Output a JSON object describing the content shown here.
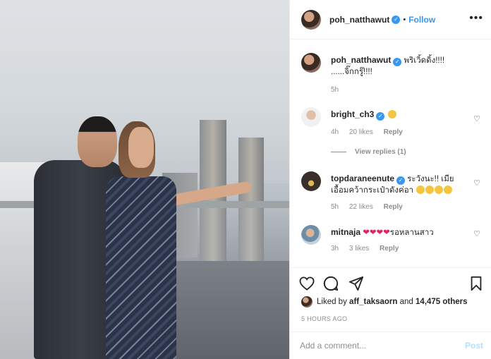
{
  "post": {
    "author": "poh_natthawut",
    "follow_label": "Follow",
    "more_label": "•••"
  },
  "caption": {
    "username": "poh_natthawut",
    "text_line1": "พริเวิ้ดดิ้ง!!!!",
    "text_line2": "......จิ๊กกรู๊!!!!",
    "time": "5h"
  },
  "comments": [
    {
      "username": "bright_ch3",
      "verified": true,
      "text": "",
      "emoji": "star-struck",
      "time": "4h",
      "likes": "20 likes",
      "reply": "Reply",
      "view_replies": "View replies (1)"
    },
    {
      "username": "topdaraneenute",
      "verified": true,
      "text_line1": "ระวังนะ!! เมีย",
      "text_line2": "เอื้อมคว้ากระเป๋าดังค่อา",
      "time": "5h",
      "likes": "22 likes",
      "reply": "Reply"
    },
    {
      "username": "mitnaja",
      "verified": false,
      "text": "รอหลานสาว",
      "time": "3h",
      "likes": "3 likes",
      "reply": "Reply"
    }
  ],
  "likes": {
    "prefix": "Liked by",
    "user": "aff_taksaorn",
    "middle": "and",
    "count": "14,475 others"
  },
  "timestamp": "5 HOURS AGO",
  "add_comment": {
    "placeholder": "Add a comment...",
    "post_label": "Post"
  },
  "icons": [
    "heart-icon",
    "comment-icon",
    "share-icon",
    "bookmark-icon",
    "verified-icon",
    "more-icon"
  ],
  "colors": {
    "link": "#3897f0",
    "muted": "#8e8e8e",
    "post_disabled": "#b2dffc",
    "heart": "#e0245e"
  }
}
